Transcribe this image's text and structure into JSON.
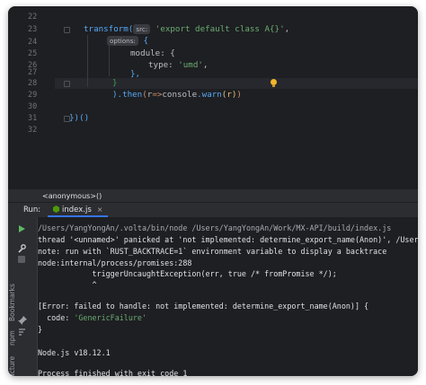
{
  "editor": {
    "line_numbers": [
      "22",
      "23",
      "24",
      "25",
      "26",
      "27",
      "28",
      "29",
      "30",
      "31",
      "32"
    ],
    "lines": {
      "l23_fn": "transform(",
      "l23_hint": "src:",
      "l23_str": "'export default class A{}'",
      "l23_comma": ",",
      "l24_hint": "options:",
      "l24_brace": "{",
      "l25_key": "module",
      "l25_colon": ": {",
      "l26_key": "type",
      "l26_colon": ": ",
      "l26_val": "'umd'",
      "l26_comma": ",",
      "l27": "},",
      "l28": "}",
      "l29_close": ")",
      "l29_then": ".then",
      "l29_paren": "(",
      "l29_r": "r",
      "l29_arrow": "=>",
      "l29_console": "console",
      "l29_warn": ".warn",
      "l29_arg": "(r)",
      "l29_end": ")",
      "l31": "})()"
    }
  },
  "breadcrumb": {
    "label": "<anonymous>()"
  },
  "run_panel": {
    "label": "Run:",
    "tab_label": "index.js",
    "tab_close": "×",
    "side_labels": [
      "Bookmarks",
      "npm",
      "ucture"
    ]
  },
  "console": {
    "lines": [
      "/Users/YangYongAn/.volta/bin/node /Users/YangYongAn/Work/MX-API/build/index.js",
      "thread '<unnamed>' panicked at 'not implemented: determine_export_name(Anon)', /Users/",
      "note: run with `RUST_BACKTRACE=1` environment variable to display a backtrace",
      "node:internal/process/promises:288",
      "            triggerUncaughtException(err, true /* fromPromise */);",
      "            ^",
      "",
      "[Error: failed to handle: not implemented: determine_export_name(Anon)] {",
      "  code: ",
      "}",
      "",
      "Node.js v18.12.1",
      "",
      "Process finished with exit code 1"
    ],
    "code_value": "'GenericFailure'"
  },
  "colors": {
    "editor_bg": "#1e1f22",
    "panel_bg": "#2b2d30",
    "string": "#6aab73",
    "keyword": "#cf8e6d",
    "function": "#56a8f5",
    "accent": "#3574f0",
    "run_green": "#5fb865"
  },
  "icons": [
    "lightbulb-icon",
    "node-js-icon",
    "run-icon",
    "wrench-icon",
    "stop-icon",
    "pin-icon"
  ]
}
